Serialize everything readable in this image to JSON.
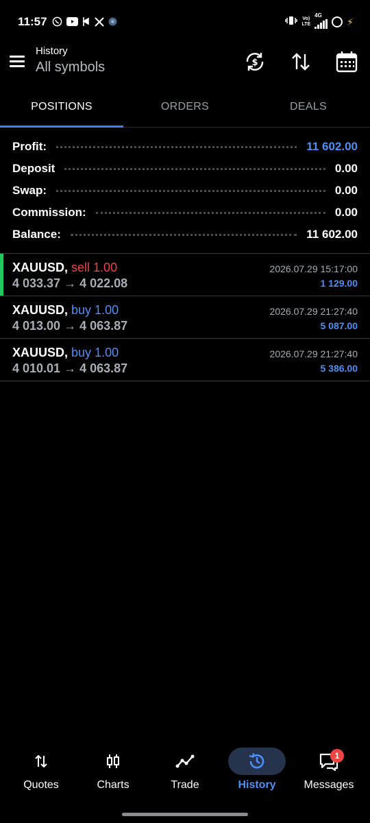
{
  "status_bar": {
    "time": "11:57",
    "carrier_top": "Vo)",
    "carrier_bottom": "LTE",
    "network": "4G"
  },
  "header": {
    "title": "History",
    "subtitle": "All symbols"
  },
  "tabs": [
    {
      "label": "POSITIONS",
      "active": true
    },
    {
      "label": "ORDERS",
      "active": false
    },
    {
      "label": "DEALS",
      "active": false
    }
  ],
  "summary": {
    "profit_label": "Profit:",
    "profit_value": "11 602.00",
    "deposit_label": "Deposit",
    "deposit_value": "0.00",
    "swap_label": "Swap:",
    "swap_value": "0.00",
    "commission_label": "Commission:",
    "commission_value": "0.00",
    "balance_label": "Balance:",
    "balance_value": "11 602.00"
  },
  "deals": [
    {
      "symbol": "XAUUSD,",
      "side": "sell 1.00",
      "direction": "sell",
      "prices": "4 033.37 → 4 022.08",
      "time": "2026.07.29 15:17:00",
      "profit": "1 129.00"
    },
    {
      "symbol": "XAUUSD,",
      "side": "buy 1.00",
      "direction": "buy",
      "prices": "4 013.00 → 4 063.87",
      "time": "2026.07.29 21:27:40",
      "profit": "5 087.00"
    },
    {
      "symbol": "XAUUSD,",
      "side": "buy 1.00",
      "direction": "buy",
      "prices": "4 010.01 → 4 063.87",
      "time": "2026.07.29 21:27:40",
      "profit": "5 386.00"
    }
  ],
  "bottom_nav": {
    "quotes": "Quotes",
    "charts": "Charts",
    "trade": "Trade",
    "history": "History",
    "messages": "Messages",
    "messages_badge": "1"
  },
  "colors": {
    "accent": "#4f8ff7",
    "sell": "#ef4444",
    "highlight": "#22c55e"
  }
}
